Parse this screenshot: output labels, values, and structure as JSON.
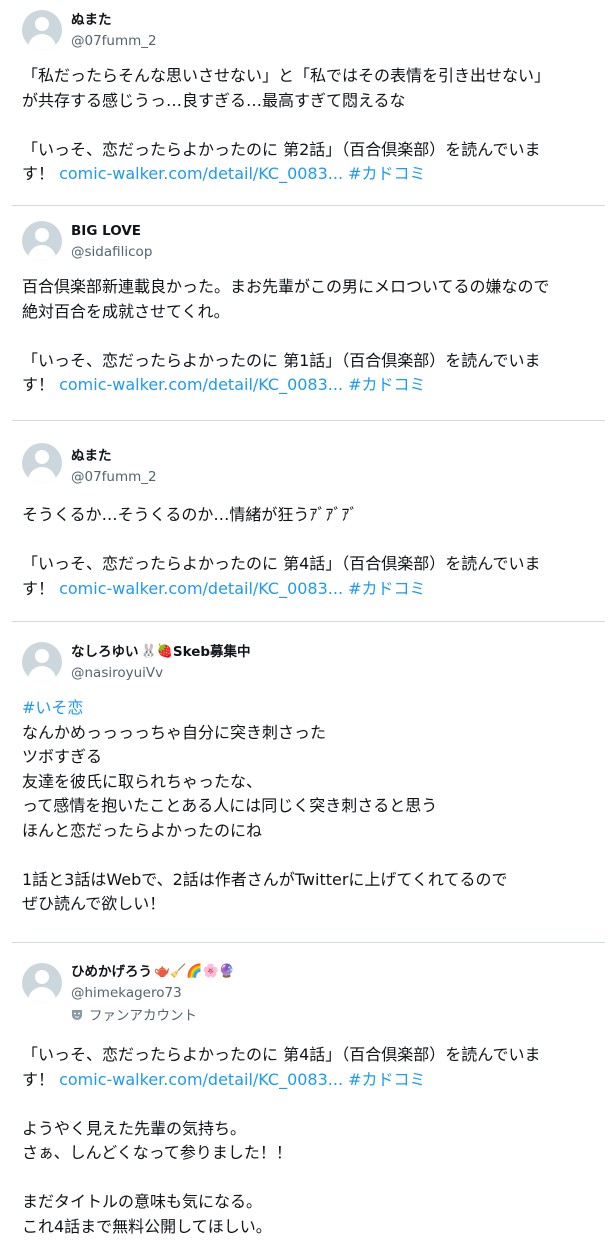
{
  "tweets": [
    {
      "name": "ぬまた",
      "handle": "@07fumm_2",
      "lines": [
        "「私だったらそんな思いさせない」と「私ではその表情を引き出せない」",
        "が共存する感じうっ…良すぎる…最高すぎて悶えるな",
        "",
        "「いっそ、恋だったらよかったのに 第2話」（百合倶楽部）を読んでいま"
      ],
      "last_prefix": "す！ ",
      "link_url": "comic-walker.com/detail/KC_0083...",
      "hashtag": "#カドコミ"
    },
    {
      "name": "BIG LOVE",
      "handle": "@sidafilicop",
      "lines": [
        "百合倶楽部新連載良かった。まお先輩がこの男にメロついてるの嫌なので",
        "絶対百合を成就させてくれ。",
        "",
        "「いっそ、恋だったらよかったのに 第1話」（百合倶楽部）を読んでいま"
      ],
      "last_prefix": "す！ ",
      "link_url": "comic-walker.com/detail/KC_0083...",
      "hashtag": "#カドコミ"
    },
    {
      "name": "ぬまた",
      "handle": "@07fumm_2",
      "lines": [
        "そうくるか…そうくるのか…情緒が狂うｱﾞｱﾞｱﾞ",
        "",
        "「いっそ、恋だったらよかったのに 第4話」（百合倶楽部）を読んでいま"
      ],
      "last_prefix": "す！ ",
      "link_url": "comic-walker.com/detail/KC_0083...",
      "hashtag": "#カドコミ"
    },
    {
      "name": "なしろゆい",
      "name_emojis": "🐰🍓",
      "name_suffix": "Skeb募集中",
      "handle": "@nasiroyuiVv",
      "hashtag_line": "#いそ恋",
      "lines": [
        "なんかめっっっっちゃ自分に突き刺さった",
        "ツボすぎる",
        "友達を彼氏に取られちゃったな、",
        "って感情を抱いたことある人には同じく突き刺さると思う",
        "ほんと恋だったらよかったのにね",
        "",
        "1話と3話はWebで、2話は作者さんがTwitterに上げてくれてるので",
        "ぜひ読んで欲しい！"
      ]
    },
    {
      "name": "ひめかげろう",
      "name_emojis": "🫖🧹🌈🌸🔮",
      "handle": "@himekagero73",
      "badge_icon": "theater-mask-icon",
      "badge_label": "ファンアカウント",
      "lines_before": [
        "「いっそ、恋だったらよかったのに 第4話」（百合倶楽部）を読んでいま"
      ],
      "last_prefix": "す！ ",
      "link_url": "comic-walker.com/detail/KC_0083...",
      "hashtag": "#カドコミ",
      "lines_after": [
        "",
        "ようやく見えた先輩の気持ち。",
        "さぁ、しんどくなって参りました！！",
        "",
        "まだタイトルの意味も気になる。",
        "これ4話まで無料公開してほしい。"
      ]
    }
  ],
  "colors": {
    "link": "#1d9bf0",
    "separator": "#cfd9de",
    "handle": "#536471",
    "avatar_bg": "#ccd6dd"
  }
}
